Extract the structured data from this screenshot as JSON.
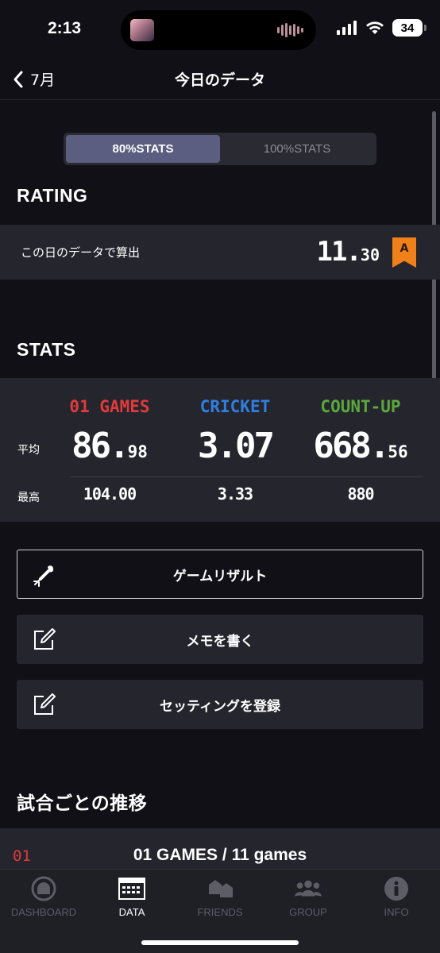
{
  "status_bar": {
    "time": "2:13",
    "battery": "34"
  },
  "nav": {
    "back_label": "7月",
    "title": "今日のデータ"
  },
  "stats_toggle": {
    "options": [
      "80%STATS",
      "100%STATS"
    ],
    "selected": "80%STATS"
  },
  "rating": {
    "section_title": "RATING",
    "label": "この日のデータで算出",
    "value_int": "11.",
    "value_dec": "30",
    "flag": "A",
    "flag_color": "#f0801a"
  },
  "stats": {
    "section_title": "STATS",
    "avg_label": "平均",
    "max_label": "最高",
    "columns": [
      {
        "name": "01 GAMES",
        "color": "#e03a3a",
        "avg_int": "86.",
        "avg_dec": "98",
        "max": "104.00"
      },
      {
        "name": "CRICKET",
        "color": "#2f7fe0",
        "avg_int": "3.07",
        "avg_dec": "",
        "max": "3.33"
      },
      {
        "name": "COUNT-UP",
        "color": "#5aa83c",
        "avg_int": "668.",
        "avg_dec": "56",
        "max": "880"
      }
    ]
  },
  "actions": {
    "game_result": "ゲームリザルト",
    "write_memo": "メモを書く",
    "register_setting": "セッティングを登録"
  },
  "transitions": {
    "section_title": "試合ごとの推移",
    "row_number": "01",
    "row_title": "01 GAMES / 11 games"
  },
  "tabbar": {
    "items": [
      {
        "label": "DASHBOARD",
        "icon": "dashboard-icon",
        "active": false
      },
      {
        "label": "DATA",
        "icon": "data-icon",
        "active": true
      },
      {
        "label": "FRIENDS",
        "icon": "friends-icon",
        "active": false
      },
      {
        "label": "GROUP",
        "icon": "group-icon",
        "active": false
      },
      {
        "label": "INFO",
        "icon": "info-icon",
        "active": false
      }
    ]
  }
}
